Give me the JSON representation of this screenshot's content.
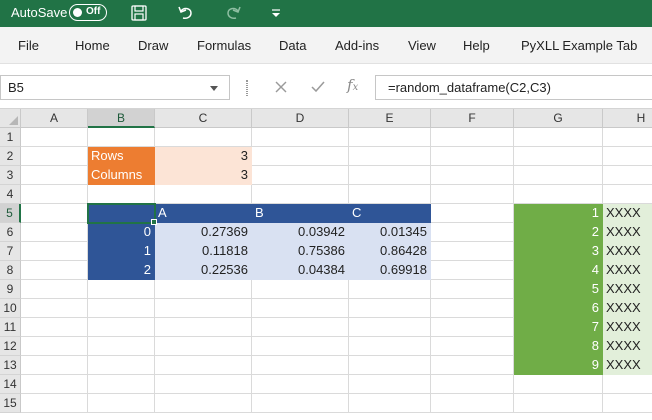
{
  "titlebar": {
    "autosave_label": "AutoSave",
    "toggle_text": "Off",
    "icons": [
      "save-icon",
      "undo-icon",
      "redo-icon",
      "customize-qat-icon"
    ]
  },
  "menu": {
    "items": [
      "File",
      "Home",
      "Draw",
      "Formulas",
      "Data",
      "Add-ins",
      "View",
      "Help",
      "PyXLL Example Tab"
    ]
  },
  "formula_bar": {
    "name_box": "B5",
    "icons": [
      "cancel-icon",
      "enter-icon",
      "fx-icon"
    ],
    "formula": "=random_dataframe(C2,C3)"
  },
  "grid": {
    "columns": [
      "A",
      "B",
      "C",
      "D",
      "E",
      "F",
      "G",
      "H"
    ],
    "selected_column": "B",
    "rows": [
      "1",
      "2",
      "3",
      "4",
      "5",
      "6",
      "7",
      "8",
      "9",
      "10",
      "11",
      "12",
      "13",
      "14",
      "15"
    ],
    "selected_row": "5",
    "params": [
      {
        "label": "Rows",
        "value": "3"
      },
      {
        "label": "Columns",
        "value": "3"
      }
    ],
    "dataframe": {
      "headers": [
        "A",
        "B",
        "C"
      ],
      "index": [
        "0",
        "1",
        "2"
      ],
      "values": [
        [
          "0.27369",
          "0.03942",
          "0.01345"
        ],
        [
          "0.11818",
          "0.75386",
          "0.86428"
        ],
        [
          "0.22536",
          "0.04384",
          "0.69918"
        ]
      ]
    },
    "list": {
      "numbers": [
        "1",
        "2",
        "3",
        "4",
        "5",
        "6",
        "7",
        "8",
        "9"
      ],
      "values": [
        "XXXX",
        "XXXX",
        "XXXX",
        "XXXX",
        "XXXX",
        "XXXX",
        "XXXX",
        "XXXX",
        "XXXX"
      ]
    }
  },
  "colors": {
    "excel_green": "#217346",
    "param_label_fill": "#ed7d31",
    "param_value_fill": "#fce4d6",
    "df_header_fill": "#2f5597",
    "df_body_fill": "#d9e1f2",
    "list_number_fill": "#70ad47",
    "list_value_fill": "#e2efda"
  }
}
